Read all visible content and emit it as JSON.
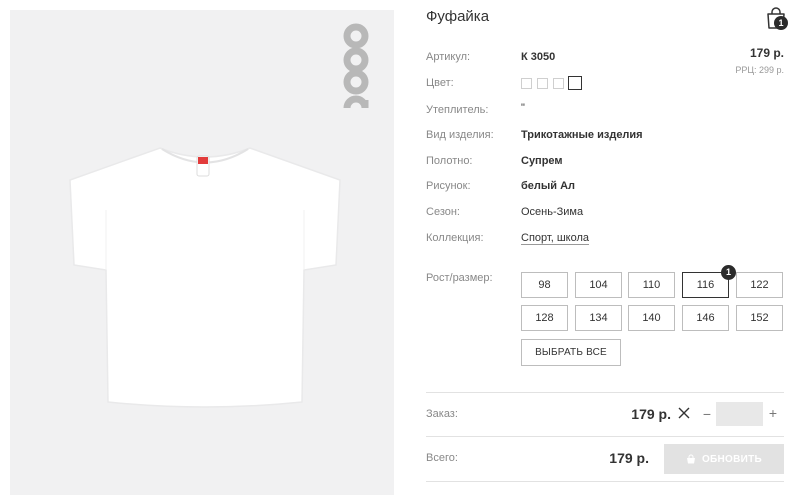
{
  "product": {
    "title": "Фуфайка",
    "price": "179 р.",
    "rrp": "РРЦ: 299 р.",
    "cart_count": "1",
    "brand": "acoola"
  },
  "attributes": [
    {
      "label": "Артикул:",
      "value": "К 3050"
    },
    {
      "label": "Цвет:"
    },
    {
      "label": "Утеплитель:",
      "value": "\""
    },
    {
      "label": "Вид изделия:",
      "value": "Трикотажные изделия"
    },
    {
      "label": "Полотно:",
      "value": "Супрем"
    },
    {
      "label": "Рисунок:",
      "value": "белый Ал"
    },
    {
      "label": "Сезон:",
      "value": "Осень-Зима"
    },
    {
      "label": "Коллекция:",
      "value": "Спорт, школа"
    }
  ],
  "sizes": {
    "label": "Рост/размер:",
    "items": [
      "98",
      "104",
      "110",
      "116",
      "122",
      "128",
      "134",
      "140",
      "146",
      "152"
    ],
    "selected": "116",
    "selected_count": "1",
    "select_all_label": "ВЫБРАТЬ ВСЕ"
  },
  "order": {
    "label": "Заказ:",
    "price": "179 р.",
    "quantity": ""
  },
  "total": {
    "label": "Всего:",
    "price": "179 р.",
    "update_label": "ОБНОВИТЬ"
  },
  "colors": {
    "photo_bg": "#f1f1f2",
    "badge": "#2b2b2b",
    "update_button": "#e2e2e2"
  }
}
